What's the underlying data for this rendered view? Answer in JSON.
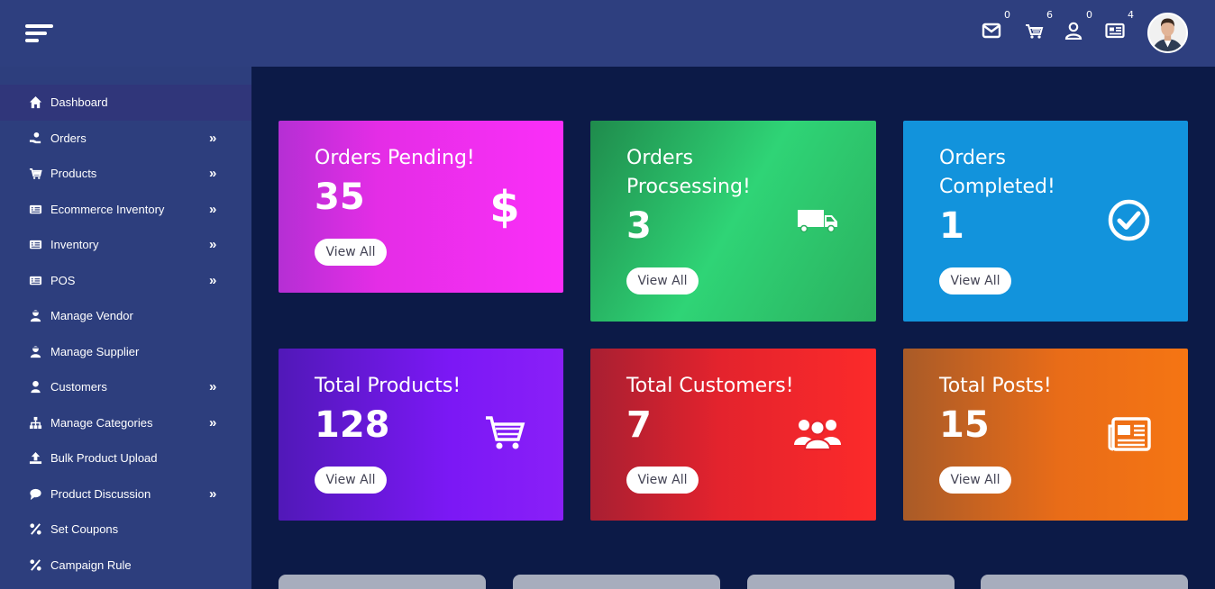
{
  "topbar": {
    "badges": {
      "mail": "0",
      "cart": "6",
      "user": "0",
      "news": "4"
    }
  },
  "sidebar": {
    "items": [
      {
        "label": "Dashboard",
        "icon": "home-icon",
        "active": true
      },
      {
        "label": "Orders",
        "icon": "hand-icon",
        "expandable": true
      },
      {
        "label": "Products",
        "icon": "cart-icon",
        "expandable": true
      },
      {
        "label": "Ecommerce Inventory",
        "icon": "list-card-icon",
        "expandable": true
      },
      {
        "label": "Inventory",
        "icon": "list-card-icon",
        "expandable": true
      },
      {
        "label": "POS",
        "icon": "list-card-icon",
        "expandable": true
      },
      {
        "label": "Manage Vendor",
        "icon": "store-user-icon"
      },
      {
        "label": "Manage Supplier",
        "icon": "store-user-icon"
      },
      {
        "label": "Customers",
        "icon": "user-icon",
        "expandable": true
      },
      {
        "label": "Manage Categories",
        "icon": "sitemap-icon",
        "expandable": true
      },
      {
        "label": "Bulk Product Upload",
        "icon": "upload-icon"
      },
      {
        "label": "Product Discussion",
        "icon": "chat-icon",
        "expandable": true
      },
      {
        "label": "Set Coupons",
        "icon": "percent-icon"
      },
      {
        "label": "Campaign Rule",
        "icon": "percent-icon"
      }
    ]
  },
  "cards": {
    "pending": {
      "title": "Orders Pending!",
      "count": "35",
      "button": "View All",
      "icon": "dollar-icon"
    },
    "processing": {
      "title_line1": "Orders",
      "title_line2": "Procsessing!",
      "count": "3",
      "button": "View All",
      "icon": "truck-icon"
    },
    "completed": {
      "title_line1": "Orders",
      "title_line2": "Completed!",
      "count": "1",
      "button": "View All",
      "icon": "check-circle-icon"
    },
    "products": {
      "title": "Total Products!",
      "count": "128",
      "button": "View All",
      "icon": "cart-icon"
    },
    "customers": {
      "title": "Total Customers!",
      "count": "7",
      "button": "View All",
      "icon": "users-icon"
    },
    "posts": {
      "title": "Total Posts!",
      "count": "15",
      "button": "View All",
      "icon": "newspaper-icon"
    }
  },
  "colors": {
    "topbar": "#2e3f7f",
    "sidebar": "#2d3e7d",
    "background": "#0c1a47",
    "pending": "#fb2ef8",
    "processing": "#2fd476",
    "completed": "#1293dc",
    "products": "#7b18f5",
    "customers": "#fc2a2a",
    "posts": "#f57513"
  }
}
